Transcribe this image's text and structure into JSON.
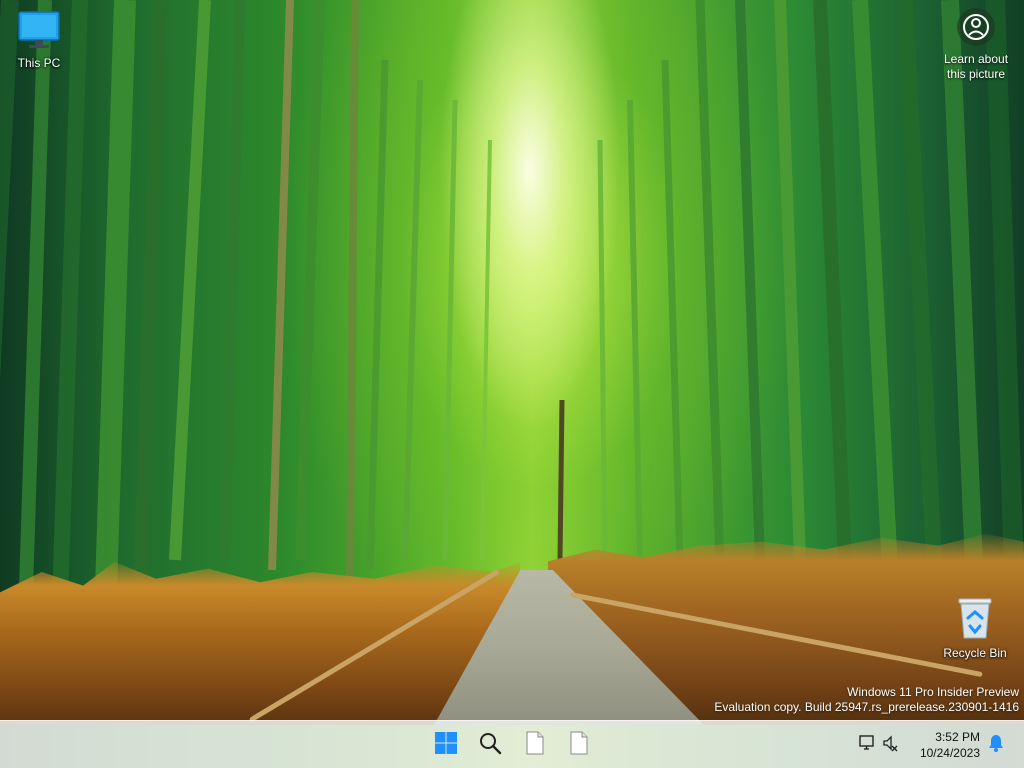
{
  "desktop": {
    "icons": [
      {
        "label": "This PC",
        "icon": "this-pc-icon"
      },
      {
        "label": "Recycle Bin",
        "icon": "recycle-bin-icon"
      }
    ],
    "spotlight": {
      "line1": "Learn about",
      "line2": "this picture",
      "icon": "spotlight-icon"
    },
    "watermark": {
      "line1": "Windows 11 Pro Insider Preview",
      "line2": "Evaluation copy. Build 25947.rs_prerelease.230901-1416"
    }
  },
  "taskbar": {
    "buttons": [
      {
        "name": "start",
        "icon": "windows-logo-icon"
      },
      {
        "name": "search",
        "icon": "search-icon"
      },
      {
        "name": "file-1",
        "icon": "document-icon"
      },
      {
        "name": "file-2",
        "icon": "document-icon"
      }
    ],
    "tray": {
      "network_icon": "network-icon",
      "volume_icon": "volume-muted-icon",
      "time": "3:52 PM",
      "date": "10/24/2023",
      "notification_icon": "bell-icon"
    },
    "colors": {
      "accent": "#0078d4",
      "start_blue": "#1e90ff"
    }
  }
}
